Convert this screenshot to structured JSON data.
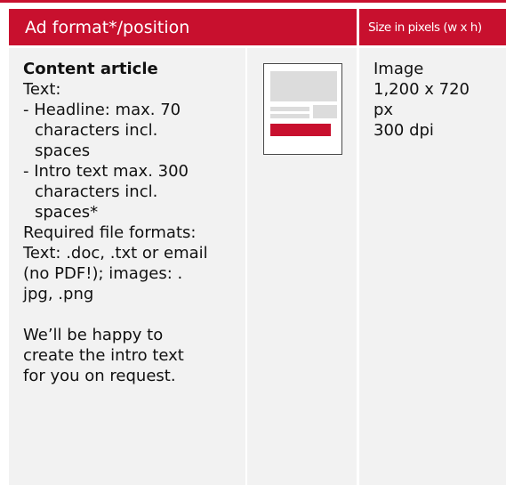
{
  "colors": {
    "accent": "#c8102e",
    "cell_background": "#f2f2f2",
    "placeholder": "#dcdcdc"
  },
  "header": {
    "col1": "Ad format*/position",
    "col2": "Size in pixels (w x h)"
  },
  "row": {
    "title": "Content article",
    "lines": [
      "Text:",
      "- Headline: max. 70",
      "characters incl.",
      "spaces",
      "- Intro text max. 300",
      "characters incl.",
      "spaces*",
      "Required file formats:",
      "Text: .doc, .txt or email",
      "(no PDF!); images: .",
      "jpg, .png",
      "We’ll be happy to",
      "create the intro text",
      "for you on request."
    ],
    "size_lines": [
      "Image",
      "1,200 x 720",
      "px",
      "300 dpi"
    ]
  }
}
